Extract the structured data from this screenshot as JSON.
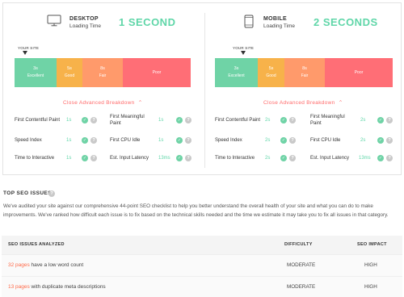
{
  "desktop": {
    "device": "DESKTOP",
    "subtitle": "Loading Time",
    "time": "1 SECOND",
    "your_site": "YOUR SITE",
    "scale": [
      {
        "time": "3s",
        "label": "Excellent",
        "color": "#6fd3a6"
      },
      {
        "time": "5s",
        "label": "Good",
        "color": "#f7b24a"
      },
      {
        "time": "8s",
        "label": "Fair",
        "color": "#ff9a6b"
      },
      {
        "time": "",
        "label": "Poor",
        "color": "#ff6e76"
      }
    ],
    "breakdown_label": "Close Advanced Breakdown",
    "metrics": [
      {
        "label": "First Contentful Paint",
        "value": "1s"
      },
      {
        "label": "First Meaningful Paint",
        "value": "1s"
      },
      {
        "label": "Speed Index",
        "value": "1s"
      },
      {
        "label": "First CPU Idle",
        "value": "1s"
      },
      {
        "label": "Time to Interactive",
        "value": "1s"
      },
      {
        "label": "Est. Input Latency",
        "value": "13ms"
      }
    ]
  },
  "mobile": {
    "device": "MOBILE",
    "subtitle": "Loading Time",
    "time": "2 SECONDS",
    "your_site": "YOUR SITE",
    "scale": [
      {
        "time": "3s",
        "label": "Excellent",
        "color": "#6fd3a6"
      },
      {
        "time": "5s",
        "label": "Good",
        "color": "#f7b24a"
      },
      {
        "time": "8s",
        "label": "Fair",
        "color": "#ff9a6b"
      },
      {
        "time": "",
        "label": "Poor",
        "color": "#ff6e76"
      }
    ],
    "breakdown_label": "Close Advanced Breakdown",
    "metrics": [
      {
        "label": "First Contentful Paint",
        "value": "2s"
      },
      {
        "label": "First Meaningful Paint",
        "value": "2s"
      },
      {
        "label": "Speed Index",
        "value": "2s"
      },
      {
        "label": "First CPU Idle",
        "value": "2s"
      },
      {
        "label": "Time to Interactive",
        "value": "2s"
      },
      {
        "label": "Est. Input Latency",
        "value": "13ms"
      }
    ]
  },
  "seo": {
    "title": "TOP SEO ISSUES",
    "description": "We've audited your site against our comprehensive 44-point SEO checklist to help you better understand the overall health of your site and what you can do to make improvements. We've ranked how difficult each issue is to fix based on the technical skills needed and the time we estimate it may take you to fix all issues in that category.",
    "table": {
      "headers": {
        "issues": "SEO ISSUES ANALYZED",
        "difficulty": "DIFFICULTY",
        "impact": "SEO IMPACT"
      },
      "rows": [
        {
          "link": "32 pages",
          "text": " have a low word count",
          "difficulty": "MODERATE",
          "impact": "HIGH"
        },
        {
          "link": "13 pages",
          "text": " with duplicate meta descriptions",
          "difficulty": "MODERATE",
          "impact": "HIGH"
        }
      ]
    }
  },
  "colors": {
    "accent_green": "#5fd6a8",
    "accent_red": "#ff6b6b",
    "link_orange": "#ff6b4a"
  }
}
